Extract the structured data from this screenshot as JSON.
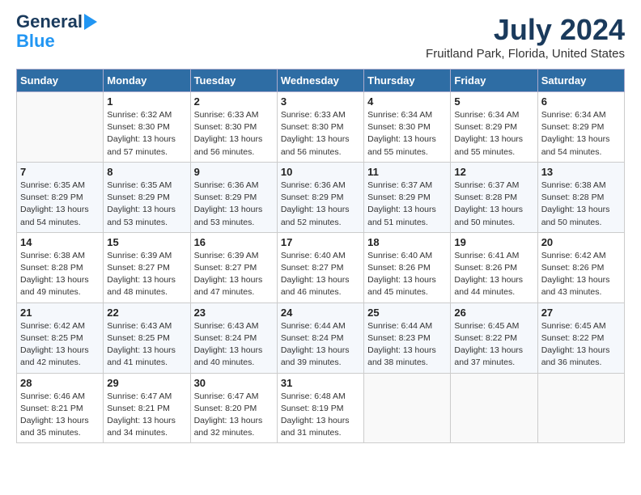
{
  "header": {
    "logo_line1": "General",
    "logo_line2": "Blue",
    "title": "July 2024",
    "subtitle": "Fruitland Park, Florida, United States"
  },
  "calendar": {
    "days_of_week": [
      "Sunday",
      "Monday",
      "Tuesday",
      "Wednesday",
      "Thursday",
      "Friday",
      "Saturday"
    ],
    "weeks": [
      [
        {
          "day": "",
          "info": ""
        },
        {
          "day": "1",
          "info": "Sunrise: 6:32 AM\nSunset: 8:30 PM\nDaylight: 13 hours\nand 57 minutes."
        },
        {
          "day": "2",
          "info": "Sunrise: 6:33 AM\nSunset: 8:30 PM\nDaylight: 13 hours\nand 56 minutes."
        },
        {
          "day": "3",
          "info": "Sunrise: 6:33 AM\nSunset: 8:30 PM\nDaylight: 13 hours\nand 56 minutes."
        },
        {
          "day": "4",
          "info": "Sunrise: 6:34 AM\nSunset: 8:30 PM\nDaylight: 13 hours\nand 55 minutes."
        },
        {
          "day": "5",
          "info": "Sunrise: 6:34 AM\nSunset: 8:29 PM\nDaylight: 13 hours\nand 55 minutes."
        },
        {
          "day": "6",
          "info": "Sunrise: 6:34 AM\nSunset: 8:29 PM\nDaylight: 13 hours\nand 54 minutes."
        }
      ],
      [
        {
          "day": "7",
          "info": "Sunrise: 6:35 AM\nSunset: 8:29 PM\nDaylight: 13 hours\nand 54 minutes."
        },
        {
          "day": "8",
          "info": "Sunrise: 6:35 AM\nSunset: 8:29 PM\nDaylight: 13 hours\nand 53 minutes."
        },
        {
          "day": "9",
          "info": "Sunrise: 6:36 AM\nSunset: 8:29 PM\nDaylight: 13 hours\nand 53 minutes."
        },
        {
          "day": "10",
          "info": "Sunrise: 6:36 AM\nSunset: 8:29 PM\nDaylight: 13 hours\nand 52 minutes."
        },
        {
          "day": "11",
          "info": "Sunrise: 6:37 AM\nSunset: 8:29 PM\nDaylight: 13 hours\nand 51 minutes."
        },
        {
          "day": "12",
          "info": "Sunrise: 6:37 AM\nSunset: 8:28 PM\nDaylight: 13 hours\nand 50 minutes."
        },
        {
          "day": "13",
          "info": "Sunrise: 6:38 AM\nSunset: 8:28 PM\nDaylight: 13 hours\nand 50 minutes."
        }
      ],
      [
        {
          "day": "14",
          "info": "Sunrise: 6:38 AM\nSunset: 8:28 PM\nDaylight: 13 hours\nand 49 minutes."
        },
        {
          "day": "15",
          "info": "Sunrise: 6:39 AM\nSunset: 8:27 PM\nDaylight: 13 hours\nand 48 minutes."
        },
        {
          "day": "16",
          "info": "Sunrise: 6:39 AM\nSunset: 8:27 PM\nDaylight: 13 hours\nand 47 minutes."
        },
        {
          "day": "17",
          "info": "Sunrise: 6:40 AM\nSunset: 8:27 PM\nDaylight: 13 hours\nand 46 minutes."
        },
        {
          "day": "18",
          "info": "Sunrise: 6:40 AM\nSunset: 8:26 PM\nDaylight: 13 hours\nand 45 minutes."
        },
        {
          "day": "19",
          "info": "Sunrise: 6:41 AM\nSunset: 8:26 PM\nDaylight: 13 hours\nand 44 minutes."
        },
        {
          "day": "20",
          "info": "Sunrise: 6:42 AM\nSunset: 8:26 PM\nDaylight: 13 hours\nand 43 minutes."
        }
      ],
      [
        {
          "day": "21",
          "info": "Sunrise: 6:42 AM\nSunset: 8:25 PM\nDaylight: 13 hours\nand 42 minutes."
        },
        {
          "day": "22",
          "info": "Sunrise: 6:43 AM\nSunset: 8:25 PM\nDaylight: 13 hours\nand 41 minutes."
        },
        {
          "day": "23",
          "info": "Sunrise: 6:43 AM\nSunset: 8:24 PM\nDaylight: 13 hours\nand 40 minutes."
        },
        {
          "day": "24",
          "info": "Sunrise: 6:44 AM\nSunset: 8:24 PM\nDaylight: 13 hours\nand 39 minutes."
        },
        {
          "day": "25",
          "info": "Sunrise: 6:44 AM\nSunset: 8:23 PM\nDaylight: 13 hours\nand 38 minutes."
        },
        {
          "day": "26",
          "info": "Sunrise: 6:45 AM\nSunset: 8:22 PM\nDaylight: 13 hours\nand 37 minutes."
        },
        {
          "day": "27",
          "info": "Sunrise: 6:45 AM\nSunset: 8:22 PM\nDaylight: 13 hours\nand 36 minutes."
        }
      ],
      [
        {
          "day": "28",
          "info": "Sunrise: 6:46 AM\nSunset: 8:21 PM\nDaylight: 13 hours\nand 35 minutes."
        },
        {
          "day": "29",
          "info": "Sunrise: 6:47 AM\nSunset: 8:21 PM\nDaylight: 13 hours\nand 34 minutes."
        },
        {
          "day": "30",
          "info": "Sunrise: 6:47 AM\nSunset: 8:20 PM\nDaylight: 13 hours\nand 32 minutes."
        },
        {
          "day": "31",
          "info": "Sunrise: 6:48 AM\nSunset: 8:19 PM\nDaylight: 13 hours\nand 31 minutes."
        },
        {
          "day": "",
          "info": ""
        },
        {
          "day": "",
          "info": ""
        },
        {
          "day": "",
          "info": ""
        }
      ]
    ]
  }
}
